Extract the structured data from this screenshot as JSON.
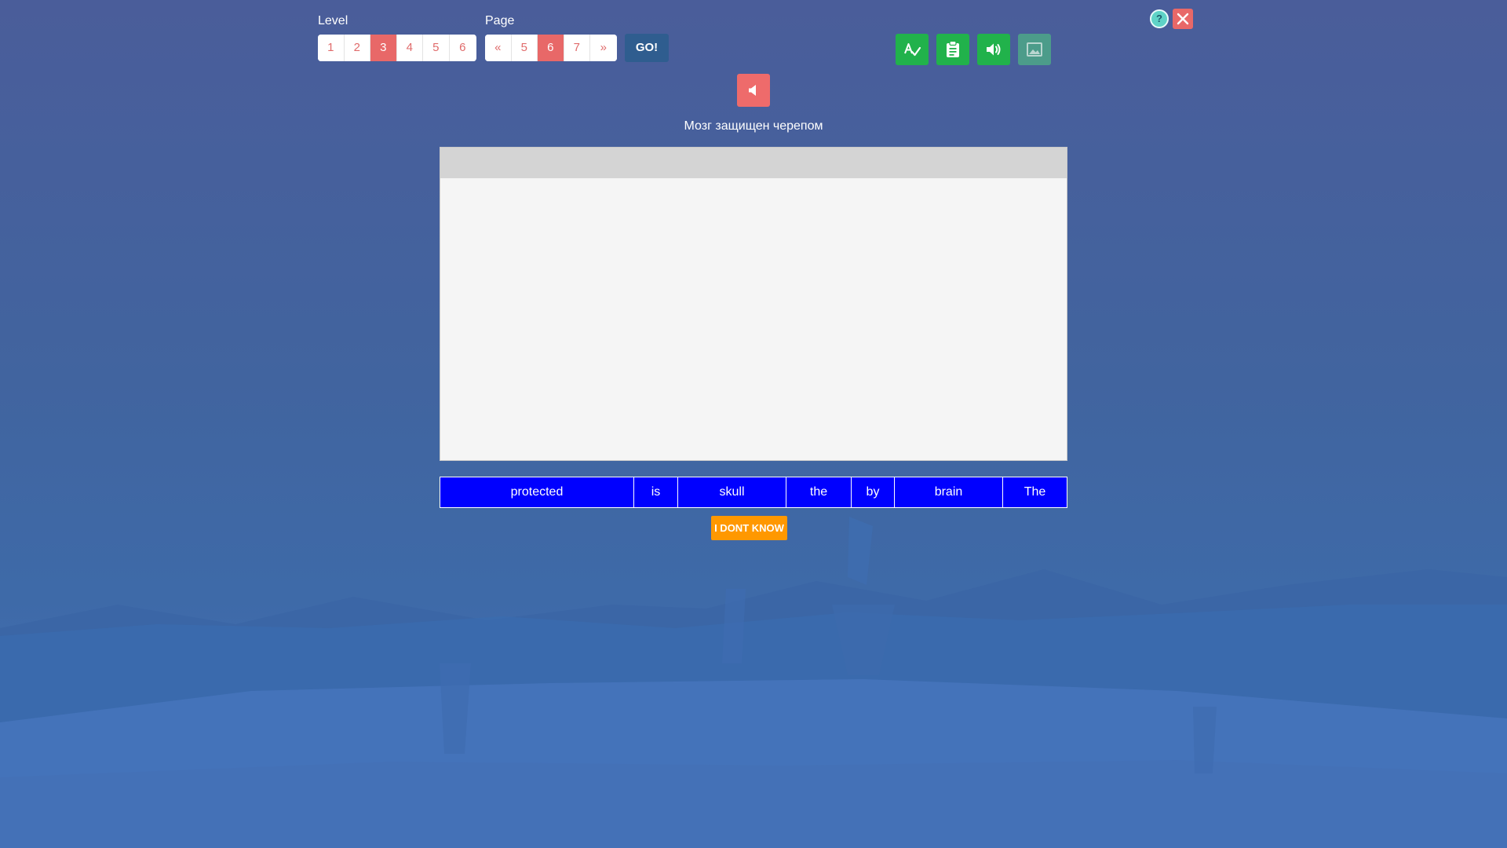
{
  "level": {
    "label": "Level",
    "items": [
      "1",
      "2",
      "3",
      "4",
      "5",
      "6"
    ],
    "selected": "3"
  },
  "page": {
    "label": "Page",
    "items": [
      "«",
      "5",
      "6",
      "7",
      "»"
    ],
    "selected": "6"
  },
  "go_label": "GO!",
  "help_label": "?",
  "toolbar": {
    "icons": [
      "spellcheck-icon",
      "clipboard-icon",
      "speaker-icon",
      "image-icon"
    ],
    "accent": "#21b24b"
  },
  "prompt": "Мозг защищен черепом",
  "words": [
    "protected",
    "is",
    "skull",
    "the",
    "by",
    "brain",
    "The"
  ],
  "idk_label": "I DONT KNOW",
  "colors": {
    "word_bg": "#0000ff",
    "active": "#e86868",
    "idk": "#ff9800"
  }
}
